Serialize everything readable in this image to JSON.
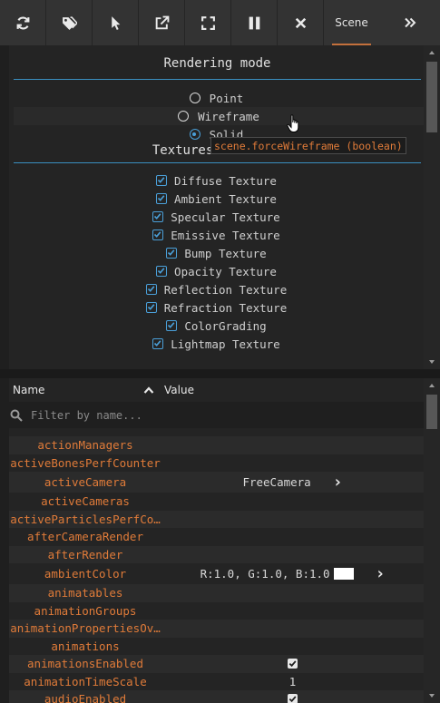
{
  "toolbar": {
    "buttons": [
      {
        "icon": "refresh-icon"
      },
      {
        "icon": "tags-icon"
      },
      {
        "icon": "pointer-icon"
      },
      {
        "icon": "popout-icon"
      },
      {
        "icon": "fullscreen-icon"
      },
      {
        "icon": "pause-icon"
      },
      {
        "icon": "close-icon"
      }
    ],
    "active_tab": "Scene",
    "more_icon": "double-chevron-right-icon",
    "accent_color": "#c3703c"
  },
  "rendering": {
    "title": "Rendering mode",
    "options": [
      {
        "label": "Point",
        "selected": false
      },
      {
        "label": "Wireframe",
        "selected": false
      },
      {
        "label": "Solid",
        "selected": true
      }
    ],
    "tooltip": "scene.forceWireframe (boolean)"
  },
  "textures": {
    "title": "Textures channels",
    "items": [
      "Diffuse Texture",
      "Ambient Texture",
      "Specular Texture",
      "Emissive Texture",
      "Bump Texture",
      "Opacity Texture",
      "Reflection Texture",
      "Refraction Texture",
      "ColorGrading",
      "Lightmap Texture"
    ]
  },
  "property_grid": {
    "name_header": "Name",
    "value_header": "Value",
    "filter_placeholder": "Filter by name...",
    "rows": [
      {
        "name": "actionManagers",
        "value": ""
      },
      {
        "name": "activeBonesPerfCounter",
        "value": ""
      },
      {
        "name": "activeCamera",
        "value": "FreeCamera",
        "expandable": true
      },
      {
        "name": "activeCameras",
        "value": ""
      },
      {
        "name": "activeParticlesPerfCo…",
        "value": ""
      },
      {
        "name": "afterCameraRender",
        "value": ""
      },
      {
        "name": "afterRender",
        "value": ""
      },
      {
        "name": "ambientColor",
        "value": "R:1.0, G:1.0, B:1.0",
        "swatch": "#ffffff",
        "expandable": true
      },
      {
        "name": "animatables",
        "value": ""
      },
      {
        "name": "animationGroups",
        "value": ""
      },
      {
        "name": "animationPropertiesOv…",
        "value": ""
      },
      {
        "name": "animations",
        "value": ""
      },
      {
        "name": "animationsEnabled",
        "value": "",
        "checked": true
      },
      {
        "name": "animationTimeScale",
        "value": "1"
      },
      {
        "name": "audioEnabled",
        "value": "",
        "checked": true
      }
    ],
    "name_color": "#e07b39"
  },
  "accent_color": "#4a9fd8"
}
